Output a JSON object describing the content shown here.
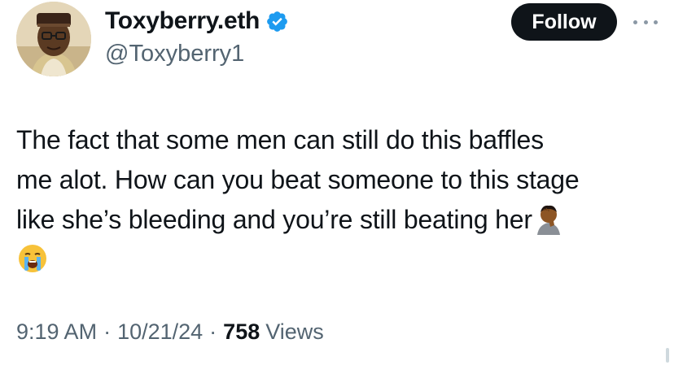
{
  "author": {
    "display_name": "Toxyberry.eth",
    "handle": "@Toxyberry1",
    "verified": true,
    "verified_icon": "verified-badge-icon",
    "verified_color": "#1d9bf0"
  },
  "actions": {
    "follow_label": "Follow",
    "more_icon": "more-options-icon"
  },
  "tweet": {
    "lines": [
      "The fact that some men can still do this baffles",
      "me alot. How can you beat someone to this stage",
      "like she’s bleeding and you’re still beating her"
    ],
    "emojis": [
      "man-facepalming-emoji",
      "loudly-crying-face-emoji"
    ]
  },
  "meta": {
    "time": "9:19 AM",
    "separator": "·",
    "date": "10/21/24",
    "views_count": "758",
    "views_label": "Views"
  },
  "colors": {
    "text_primary": "#0f1419",
    "text_secondary": "#536471",
    "follow_bg": "#0f1419",
    "follow_text": "#ffffff",
    "verified_blue": "#1d9bf0"
  }
}
